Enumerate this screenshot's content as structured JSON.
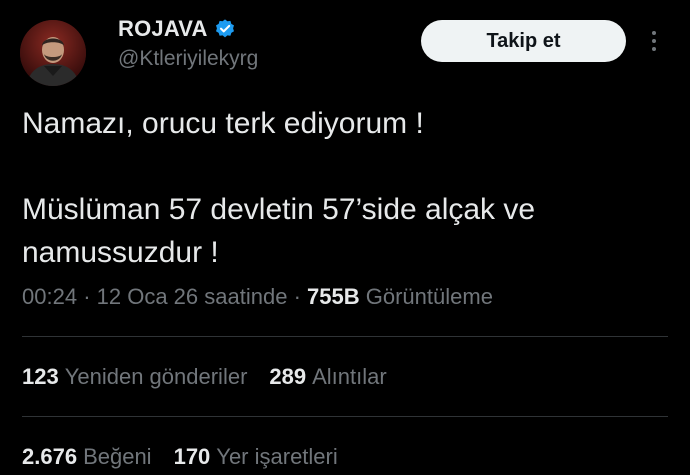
{
  "author": {
    "display_name": "ROJAVA",
    "handle": "@Ktleriyilekyrg",
    "verified_color": "#1d9bf0"
  },
  "actions": {
    "follow_label": "Takip et",
    "more_icon": "more-vertical-icon"
  },
  "tweet": {
    "line1": "Namazı, orucu terk ediyorum !",
    "line2": "Müslüman 57 devletin 57’side alçak ve",
    "line3": "namussuzdur !"
  },
  "meta": {
    "time": "00:24",
    "separator": "·",
    "date": "12 Oca 26 saatinde",
    "views_count": "755B",
    "views_label": "Görüntüleme"
  },
  "stats": {
    "retweets_count": "123",
    "retweets_label": "Yeniden gönderiler",
    "quotes_count": "289",
    "quotes_label": "Alıntılar",
    "likes_count": "2.676",
    "likes_label": "Beğeni",
    "bookmarks_count": "170",
    "bookmarks_label": "Yer işaretleri"
  },
  "colors": {
    "background": "#000000",
    "text_primary": "#e7e9ea",
    "text_secondary": "#71767b",
    "divider": "#2f3336",
    "button_bg": "#eff3f4"
  }
}
